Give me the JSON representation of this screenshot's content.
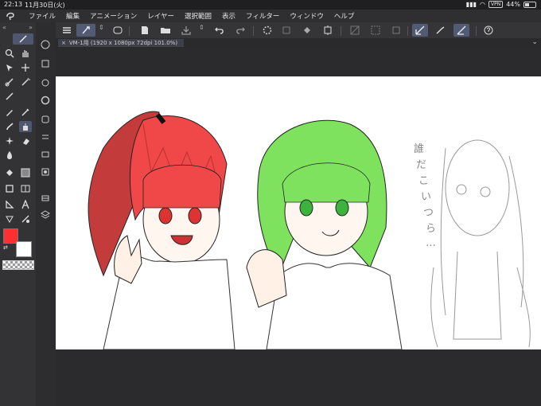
{
  "status": {
    "time": "22:13",
    "date": "11月30日(火)",
    "vpn": "VPN",
    "battery": "44%",
    "battery_level": 0.44
  },
  "menu": {
    "items": [
      "ファイル",
      "編集",
      "アニメーション",
      "レイヤー",
      "選択範囲",
      "表示",
      "フィルター",
      "ウィンドウ",
      "ヘルプ"
    ]
  },
  "document": {
    "tab_label": "VM-1用 (1920 x 1080px 72dpi 101.0%)",
    "close": "×",
    "expand": "⌄"
  },
  "canvas": {
    "sketch_text": [
      "誰",
      "だ",
      "こ",
      "い",
      "つ",
      "ら",
      "…"
    ]
  },
  "colors": {
    "main": "#ff2f2f",
    "sub": "#ffffff",
    "accent": "#515b73"
  },
  "icons": {
    "menu": "hamburger-icon",
    "brush": "brush-icon",
    "lasso": "lasso-icon"
  }
}
